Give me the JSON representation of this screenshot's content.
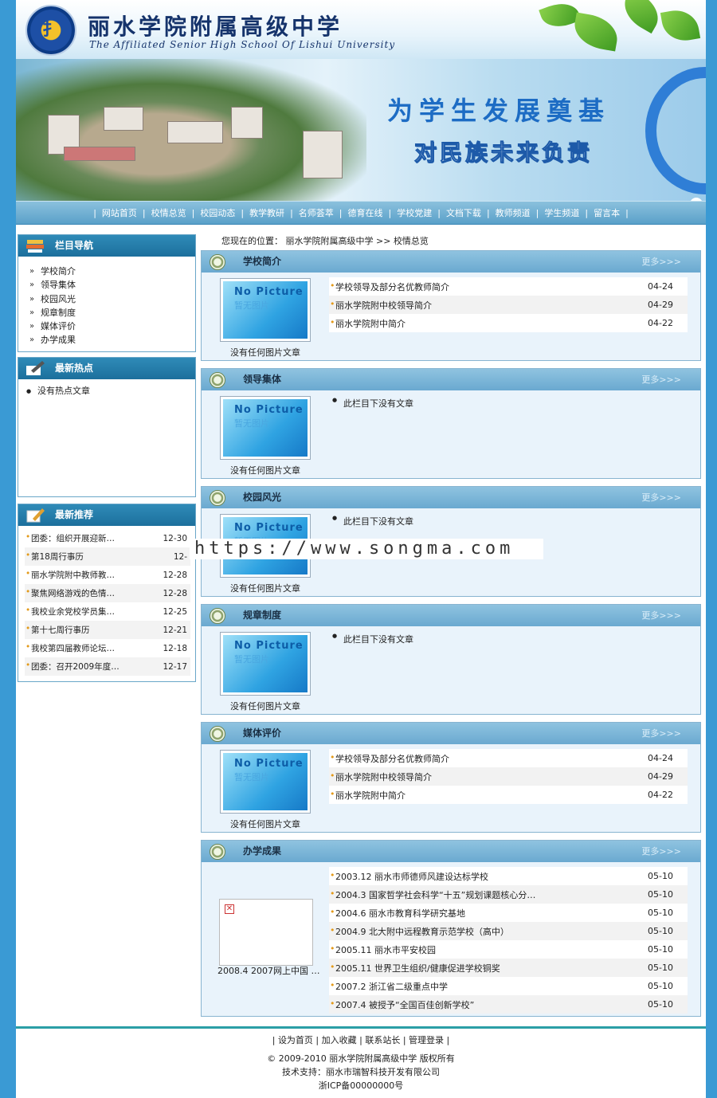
{
  "header": {
    "school_name": "丽水学院附属高级中学",
    "school_name_en": "The Affiliated Senior High School Of Lishui University"
  },
  "banner": {
    "slogan_line1": "为学生发展奠基",
    "slogan_line2": "对民族未来负责"
  },
  "nav": {
    "items": [
      "网站首页",
      "校情总览",
      "校园动态",
      "教学教研",
      "名师荟萃",
      "德育在线",
      "学校党建",
      "文档下载",
      "教师频道",
      "学生频道",
      "留言本"
    ]
  },
  "sidebar": {
    "category_title": "栏目导航",
    "categories": [
      "学校简介",
      "领导集体",
      "校园风光",
      "规章制度",
      "媒体评价",
      "办学成果"
    ],
    "hot_title": "最新热点",
    "hot_items": [
      "没有热点文章"
    ],
    "recommend_title": "最新推荐",
    "recommend_items": [
      {
        "title": "团委：组织开展迎新…",
        "date": "12-30"
      },
      {
        "title": "第18周行事历",
        "date": "12-"
      },
      {
        "title": "丽水学院附中教师教…",
        "date": "12-28"
      },
      {
        "title": "聚焦网络游戏的色情…",
        "date": "12-28"
      },
      {
        "title": "我校业余党校学员集…",
        "date": "12-25"
      },
      {
        "title": "第十七周行事历",
        "date": "12-21"
      },
      {
        "title": "我校第四届教师论坛…",
        "date": "12-18"
      },
      {
        "title": "团委：召开2009年度…",
        "date": "12-17"
      }
    ]
  },
  "location": {
    "label": "您现在的位置：",
    "home": "丽水学院附属高级中学",
    "sep": ">>",
    "current": "校情总览"
  },
  "sections": [
    {
      "title": "学校简介",
      "more": "更多>>>",
      "caption": "没有任何图片文章",
      "articles": [
        {
          "title": "学校领导及部分名优教师简介",
          "date": "04-24"
        },
        {
          "title": "丽水学院附中校领导简介",
          "date": "04-29"
        },
        {
          "title": "丽水学院附中简介",
          "date": "04-22"
        }
      ]
    },
    {
      "title": "领导集体",
      "more": "更多>>>",
      "caption": "没有任何图片文章",
      "empty": "此栏目下没有文章"
    },
    {
      "title": "校园风光",
      "more": "更多>>>",
      "caption": "没有任何图片文章",
      "empty": "此栏目下没有文章"
    },
    {
      "title": "规章制度",
      "more": "更多>>>",
      "caption": "没有任何图片文章",
      "empty": "此栏目下没有文章"
    },
    {
      "title": "媒体评价",
      "more": "更多>>>",
      "caption": "没有任何图片文章",
      "articles": [
        {
          "title": "学校领导及部分名优教师简介",
          "date": "04-24"
        },
        {
          "title": "丽水学院附中校领导简介",
          "date": "04-29"
        },
        {
          "title": "丽水学院附中简介",
          "date": "04-22"
        }
      ]
    },
    {
      "title": "办学成果",
      "more": "更多>>>",
      "caption": "2008.4 2007网上中国 …",
      "articles": [
        {
          "title": "2003.12 丽水市师德师风建设达标学校",
          "date": "05-10"
        },
        {
          "title": "2004.3 国家哲学社会科学“十五”规划课题核心分…",
          "date": "05-10"
        },
        {
          "title": "2004.6 丽水市教育科学研究基地",
          "date": "05-10"
        },
        {
          "title": "2004.9 北大附中远程教育示范学校（高中）",
          "date": "05-10"
        },
        {
          "title": "2005.11 丽水市平安校园",
          "date": "05-10"
        },
        {
          "title": "2005.11 世界卫生组织/健康促进学校铜奖",
          "date": "05-10"
        },
        {
          "title": "2007.2 浙江省二级重点中学",
          "date": "05-10"
        },
        {
          "title": "2007.4 被授予“全国百佳创新学校”",
          "date": "05-10"
        }
      ]
    }
  ],
  "thumb": {
    "line1": "No Picture",
    "line2": "暂无图片"
  },
  "watermark": "https://www.songma.com",
  "footer": {
    "links": [
      "设为首页",
      "加入收藏",
      "联系站长",
      "管理登录"
    ],
    "copyright": "© 2009-2010 丽水学院附属高级中学 版权所有",
    "support": "技术支持：丽水市瑞智科技开发有限公司",
    "icp": "浙ICP备00000000号"
  }
}
